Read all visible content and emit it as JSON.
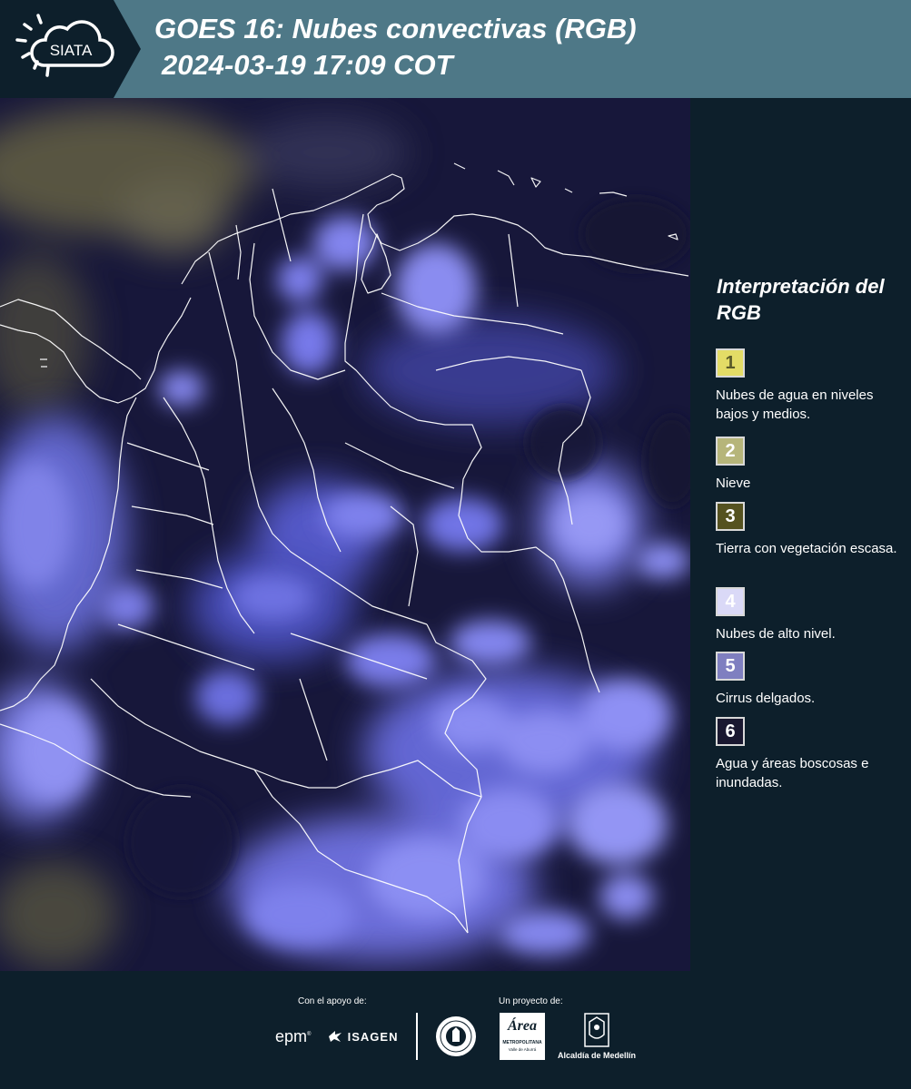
{
  "header": {
    "logo_text": "SIATA",
    "title_line1": "GOES 16: Nubes convectivas (RGB)",
    "title_line2": "2024-03-19 17:09 COT"
  },
  "map": {
    "description_icon": "satellite-image"
  },
  "legend": {
    "title": "Interpretación del RGB",
    "items": [
      {
        "number": "1",
        "color": "#e3dc66",
        "text_color": "#5a5a2a",
        "label": "Nubes de agua en niveles bajos y medios."
      },
      {
        "number": "2",
        "color": "#b6b57a",
        "text_color": "#ffffff",
        "label": "Nieve"
      },
      {
        "number": "3",
        "color": "#555220",
        "text_color": "#ffffff",
        "label": "Tierra con vegetación escasa."
      },
      {
        "number": "4",
        "color": "#dad9f7",
        "text_color": "#ffffff",
        "label": "Nubes de alto nivel."
      },
      {
        "number": "5",
        "color": "#7f7fc0",
        "text_color": "#ffffff",
        "label": "Cirrus delgados."
      },
      {
        "number": "6",
        "color": "#1a1830",
        "text_color": "#ffffff",
        "label": "Agua y áreas boscosas e inundadas."
      }
    ]
  },
  "footer": {
    "support_label": "Con el apoyo de:",
    "project_label": "Un proyecto de:",
    "sponsors": {
      "epm": "epm",
      "isagen": "ISAGEN",
      "area_metro": "Área",
      "area_sub": "METROPOLITANA",
      "area_sub2": "Valle de Aburrá",
      "alcaldia": "Alcaldía de Medellín"
    }
  }
}
